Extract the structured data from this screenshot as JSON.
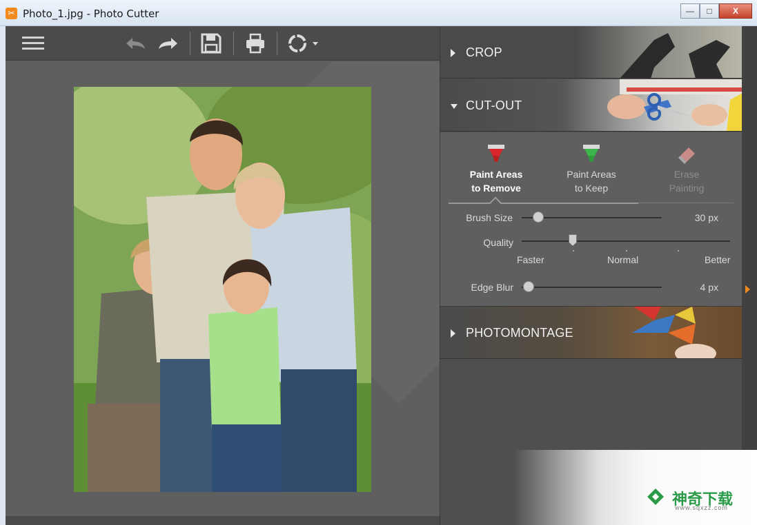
{
  "window": {
    "title": "Photo_1.jpg - Photo Cutter",
    "minimize_label": "—",
    "maximize_label": "□",
    "close_label": "X"
  },
  "toolbar": {
    "items": [
      "menu-icon",
      "undo-icon",
      "redo-icon",
      "save-icon",
      "print-icon",
      "rotate-icon"
    ]
  },
  "panel": {
    "sections": {
      "crop": "CROP",
      "cutout": "CUT-OUT",
      "photomontage": "PHOTOMONTAGE"
    },
    "tools": {
      "remove": {
        "line1": "Paint Areas",
        "line2": "to Remove"
      },
      "keep": {
        "line1": "Paint Areas",
        "line2": "to Keep"
      },
      "erase": {
        "line1": "Erase",
        "line2": "Painting"
      }
    },
    "brush_size": {
      "label": "Brush Size",
      "value": "30 px",
      "level": 0.13
    },
    "quality": {
      "label": "Quality",
      "faster": "Faster",
      "normal": "Normal",
      "better": "Better",
      "level": 0.25
    },
    "edge_blur": {
      "label": "Edge Blur",
      "value": "4 px",
      "level": 0.02
    }
  },
  "watermark": {
    "name": "神奇下载",
    "url": "www.sqxzz.com"
  },
  "colors": {
    "accent": "#f08a1c",
    "remove_marker": "#d9262b",
    "keep_marker": "#3cb54a",
    "erase_marker": "#c98b88"
  }
}
